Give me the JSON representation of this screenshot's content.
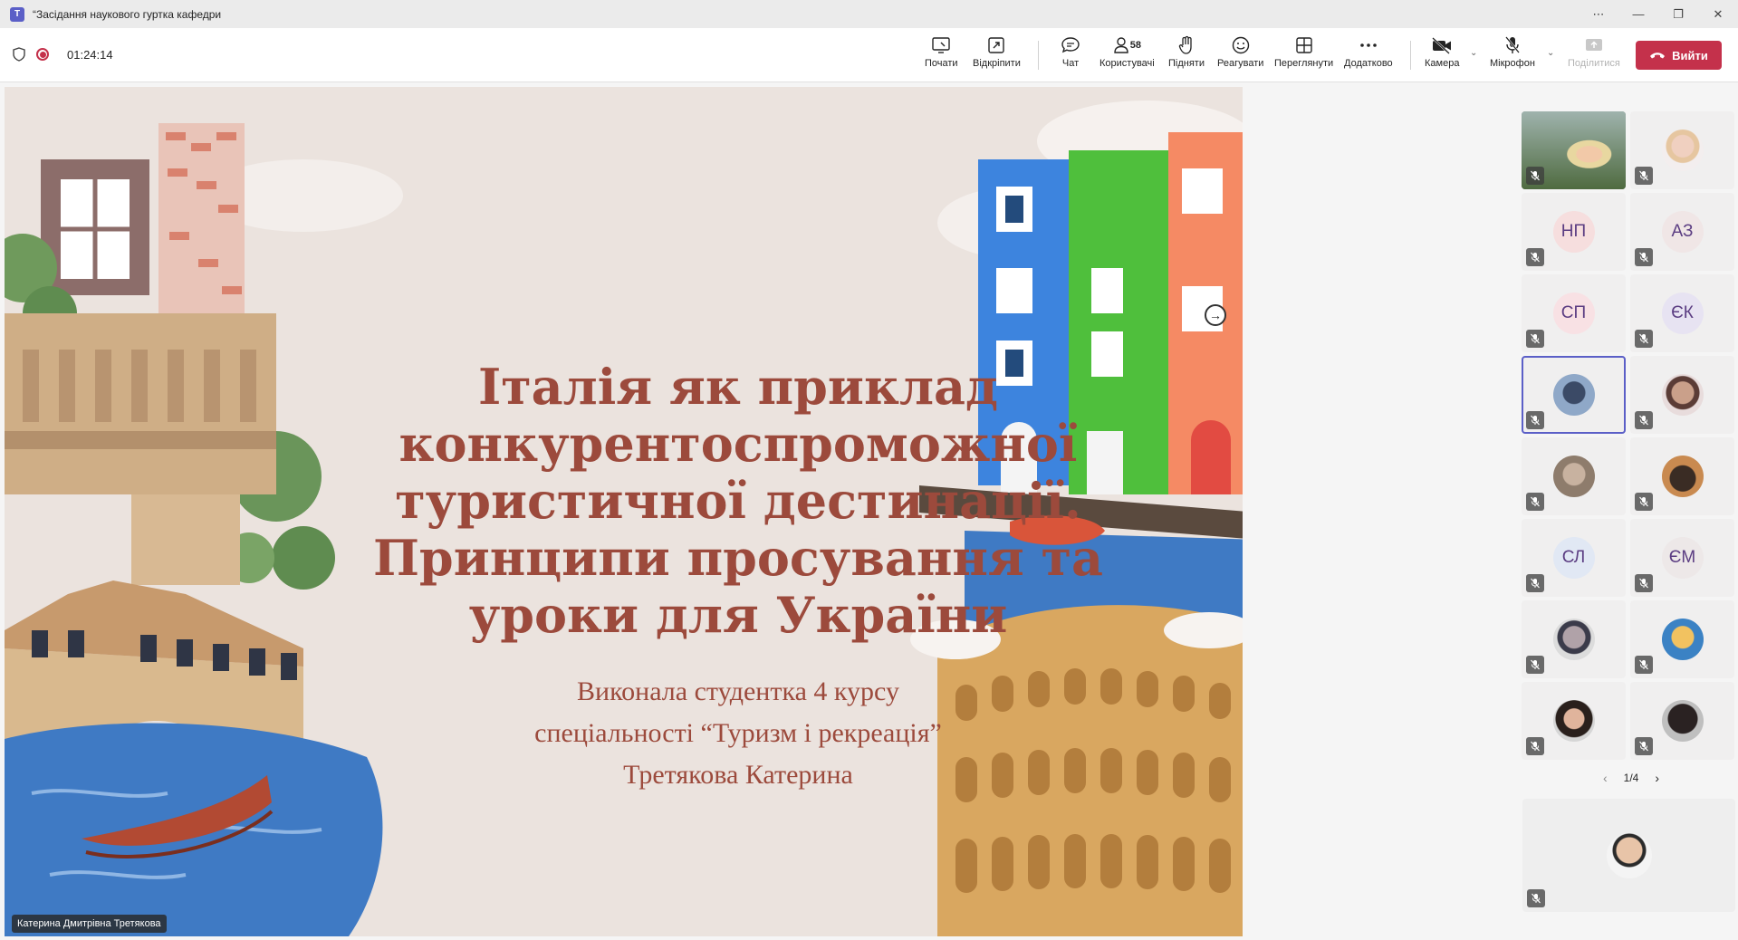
{
  "window": {
    "title": "“Засідання наукового гуртка кафедри",
    "controls": [
      "⋯",
      "—",
      "❐",
      "✕"
    ]
  },
  "toolbar": {
    "timer": "01:24:14",
    "buttons": {
      "start": "Почати",
      "unpin": "Відкріпити",
      "chat": "Чат",
      "users": "Користувачі",
      "users_count": "58",
      "raise": "Підняти",
      "react": "Реагувати",
      "view": "Переглянути",
      "more": "Додатково",
      "camera": "Камера",
      "mic": "Мікрофон",
      "share": "Поділитися",
      "leave": "Вийти"
    }
  },
  "slide": {
    "title_lines": [
      "Італія як приклад",
      "конкурентоспроможної",
      "туристичної дестинації.",
      "Принципи просування та",
      "уроки для України"
    ],
    "subtitle_lines": [
      "Виконала студентка 4 курсу",
      "спеціальності “Туризм і рекреація”",
      "Третякова Катерина"
    ]
  },
  "presenter": {
    "name": "Катерина Дмитрівна Третякова"
  },
  "participants": [
    {
      "kind": "photo"
    },
    {
      "kind": "photo"
    },
    {
      "kind": "initials",
      "initials": "НП",
      "color": "#f6dede"
    },
    {
      "kind": "initials",
      "initials": "АЗ",
      "color": "#f0e6e6"
    },
    {
      "kind": "initials",
      "initials": "СП",
      "color": "#f8e1e4"
    },
    {
      "kind": "initials",
      "initials": "ЄК",
      "color": "#e7e3f2"
    },
    {
      "kind": "photo"
    },
    {
      "kind": "photo"
    },
    {
      "kind": "photo"
    },
    {
      "kind": "photo"
    },
    {
      "kind": "initials",
      "initials": "СЛ",
      "color": "#e1e8f4"
    },
    {
      "kind": "initials",
      "initials": "ЄМ",
      "color": "#ede8e8"
    },
    {
      "kind": "photo"
    },
    {
      "kind": "photo"
    },
    {
      "kind": "photo"
    },
    {
      "kind": "photo"
    }
  ],
  "pager": {
    "label": "1/4"
  },
  "colors": {
    "accent": "#5b5fc7",
    "leave": "#c4314b",
    "slide_text": "#9c4a3c"
  }
}
